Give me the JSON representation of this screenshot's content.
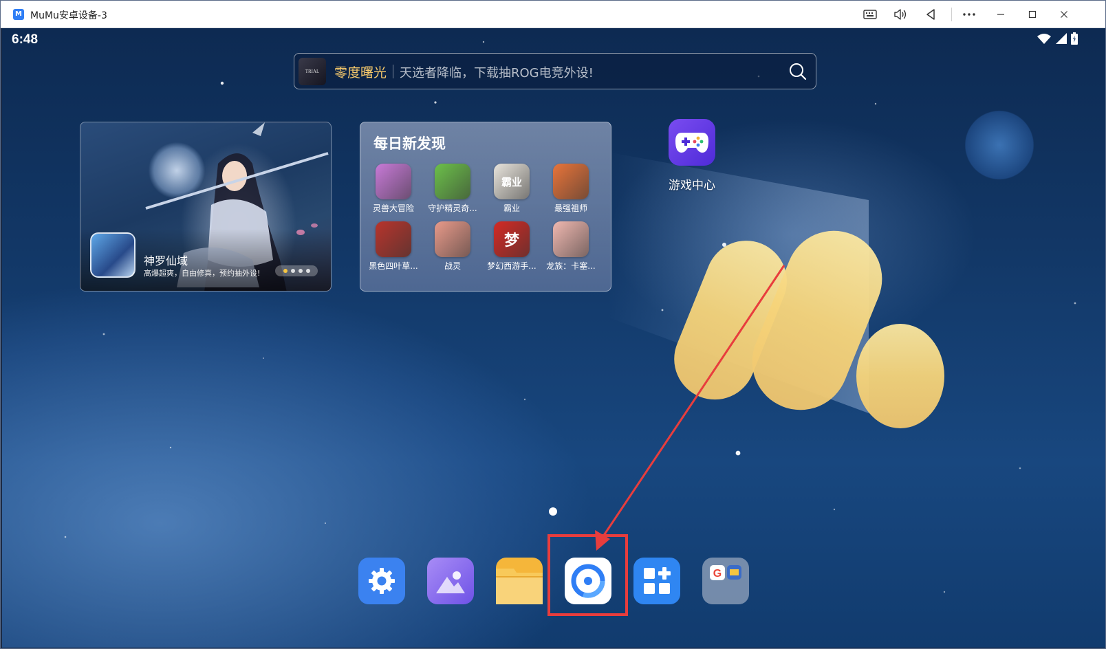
{
  "window": {
    "title": "MuMu安卓设备-3",
    "logo_text": "M"
  },
  "titlebar_buttons": [
    {
      "name": "keyboard-button",
      "icon": "keyboard-icon"
    },
    {
      "name": "volume-button",
      "icon": "speaker-icon"
    },
    {
      "name": "back-button",
      "icon": "back-triangle-icon"
    },
    {
      "name": "more-button",
      "icon": "ellipsis-icon"
    },
    {
      "name": "minimize-button",
      "icon": "minimize-icon"
    },
    {
      "name": "maximize-button",
      "icon": "maximize-icon"
    },
    {
      "name": "close-button",
      "icon": "close-icon"
    }
  ],
  "status_bar": {
    "time": "6:48",
    "icons": [
      "wifi-icon",
      "signal-icon",
      "battery-icon"
    ]
  },
  "search": {
    "thumb_text": "TRIAL",
    "brand": "零度曙光",
    "slogan": "天选者降临，下载抽ROG电竞外设!"
  },
  "promo": {
    "title": "神罗仙域",
    "desc": "高爆超爽，自由修真，预约抽外设!",
    "dots": 4,
    "active_dot": 0
  },
  "discover": {
    "title": "每日新发现",
    "games": [
      {
        "label": "灵兽大冒险",
        "color": "#c87ad8",
        "glyph": ""
      },
      {
        "label": "守护精灵奇...",
        "color": "#6cc04a",
        "glyph": ""
      },
      {
        "label": "霸业",
        "color": "#e8e4dc",
        "glyph": "霸业"
      },
      {
        "label": "最强祖师",
        "color": "#e8743a",
        "glyph": ""
      },
      {
        "label": "黑色四叶草...",
        "color": "#b8342c",
        "glyph": ""
      },
      {
        "label": "战灵",
        "color": "#e89a8a",
        "glyph": ""
      },
      {
        "label": "梦幻西游手...",
        "color": "#d42a24",
        "glyph": "梦"
      },
      {
        "label": "龙族：卡塞...",
        "color": "#f0b8b0",
        "glyph": ""
      }
    ]
  },
  "home_app": {
    "label": "游戏中心",
    "icon": "gamepad-icon"
  },
  "dock": [
    {
      "name": "settings",
      "icon": "gear-icon",
      "color": "#3b82f0"
    },
    {
      "name": "gallery",
      "icon": "image-icon",
      "color": "#8a6cf0"
    },
    {
      "name": "files",
      "icon": "folder-icon",
      "color": "#f5b63a"
    },
    {
      "name": "browser",
      "icon": "browser-ring-icon",
      "color": "#ffffff"
    },
    {
      "name": "app-store",
      "icon": "apps-plus-icon",
      "color": "#2f86f2"
    },
    {
      "name": "google-folder",
      "icon": "google-folder-icon",
      "color": "#8592aa"
    }
  ],
  "colors": {
    "accent": "#2f7ef5",
    "highlight": "#e83d3d",
    "brand_gold": "#f5c86b"
  }
}
